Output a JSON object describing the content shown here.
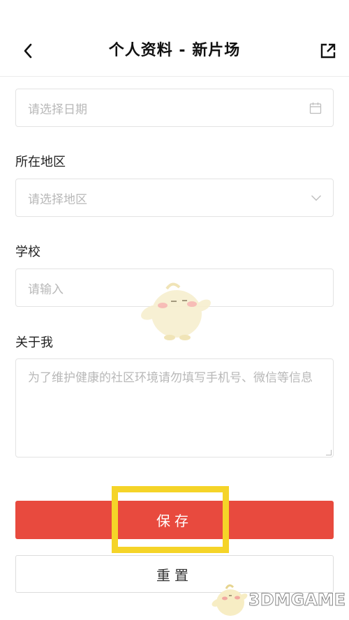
{
  "header": {
    "title": "个人资料 - 新片场",
    "back_icon": "chevron-left-icon",
    "share_icon": "external-link-icon"
  },
  "form": {
    "date": {
      "placeholder": "请选择日期",
      "icon": "calendar-icon"
    },
    "region": {
      "label": "所在地区",
      "placeholder": "请选择地区",
      "icon": "chevron-down-icon"
    },
    "school": {
      "label": "学校",
      "placeholder": "请输入"
    },
    "about": {
      "label": "关于我",
      "placeholder": "为了维护健康的社区环境请勿填写手机号、微信等信息"
    }
  },
  "buttons": {
    "save": "保存",
    "reset": "重置"
  },
  "highlight_color": "#f5d428",
  "accent_color": "#e84a3e",
  "watermark": {
    "text": "3DMGAME"
  }
}
